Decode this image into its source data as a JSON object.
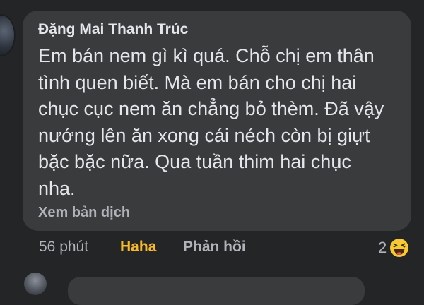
{
  "comment": {
    "author": "Đặng Mai Thanh Trúc",
    "lines": [
      "Em bán nem gì kì quá. Chỗ chị em thân",
      "tình quen biết. Mà em bán cho chị hai",
      "chục cục nem ăn chẳng bỏ thèm. Đã vậy",
      "nướng lên ăn xong cái néch còn bị giựt",
      "bặc bặc nữa. Qua tuần thim hai chục",
      "nha."
    ],
    "translate_label": "Xem bản dịch"
  },
  "actions": {
    "timestamp": "56 phút",
    "reaction_label": "Haha",
    "reply_label": "Phản hồi"
  },
  "reactions": {
    "count": "2",
    "icon": "haha-emoji-icon",
    "color": "#f7b928"
  },
  "colors": {
    "background": "#242526",
    "bubble": "#3a3b3c",
    "primary_text": "#e4e6eb",
    "secondary_text": "#b0b3b8",
    "haha_accent": "#f7b928"
  }
}
